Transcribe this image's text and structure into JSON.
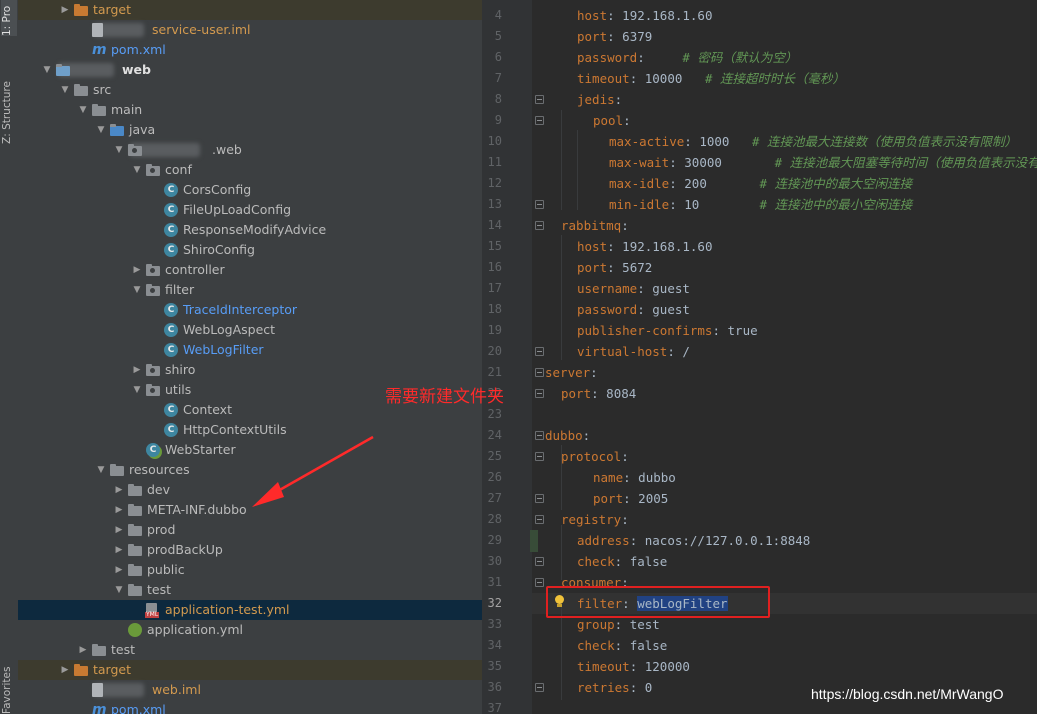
{
  "tool_tabs": {
    "project": "1: Pro",
    "structure": "Z: Structure",
    "favorites": "Favorites"
  },
  "tree": [
    {
      "label": "target",
      "icon": "folder-excluded-icon",
      "indent": 2,
      "arrow": "▶",
      "style": "orange",
      "row": "excl"
    },
    {
      "label": "service-user.iml",
      "icon": "iml-file-icon",
      "indent": 3,
      "prefix_blur": 50,
      "style": "orange"
    },
    {
      "label": "pom.xml",
      "icon": "maven-icon",
      "indent": 3,
      "style": "blue"
    },
    {
      "label": "web",
      "icon": "module-folder-icon",
      "indent": 1,
      "arrow": "▼",
      "prefix_blur": 56,
      "style": "bold"
    },
    {
      "label": "src",
      "icon": "folder-icon",
      "indent": 2,
      "arrow": "▼"
    },
    {
      "label": "main",
      "icon": "folder-icon",
      "indent": 3,
      "arrow": "▼"
    },
    {
      "label": "java",
      "icon": "source-folder-icon",
      "indent": 4,
      "arrow": "▼"
    },
    {
      "label": ".web",
      "icon": "package-icon",
      "indent": 5,
      "arrow": "▼",
      "prefix_blur": 70
    },
    {
      "label": "conf",
      "icon": "package-icon",
      "indent": 6,
      "arrow": "▼"
    },
    {
      "label": "CorsConfig",
      "icon": "class-icon",
      "indent": 7
    },
    {
      "label": "FileUpLoadConfig",
      "icon": "class-icon",
      "indent": 7
    },
    {
      "label": "ResponseModifyAdvice",
      "icon": "class-icon",
      "indent": 7
    },
    {
      "label": "ShiroConfig",
      "icon": "class-icon",
      "indent": 7
    },
    {
      "label": "controller",
      "icon": "package-icon",
      "indent": 6,
      "arrow": "▶"
    },
    {
      "label": "filter",
      "icon": "package-icon",
      "indent": 6,
      "arrow": "▼"
    },
    {
      "label": "TraceIdInterceptor",
      "icon": "class-icon",
      "indent": 7,
      "style": "blue"
    },
    {
      "label": "WebLogAspect",
      "icon": "class-icon",
      "indent": 7
    },
    {
      "label": "WebLogFilter",
      "icon": "class-icon",
      "indent": 7,
      "style": "blue"
    },
    {
      "label": "shiro",
      "icon": "package-icon",
      "indent": 6,
      "arrow": "▶"
    },
    {
      "label": "utils",
      "icon": "package-icon",
      "indent": 6,
      "arrow": "▼"
    },
    {
      "label": "Context",
      "icon": "class-icon",
      "indent": 7
    },
    {
      "label": "HttpContextUtils",
      "icon": "class-icon",
      "indent": 7
    },
    {
      "label": "WebStarter",
      "icon": "spring-boot-class-icon",
      "indent": 6
    },
    {
      "label": "resources",
      "icon": "resources-folder-icon",
      "indent": 4,
      "arrow": "▼"
    },
    {
      "label": "dev",
      "icon": "folder-icon",
      "indent": 5,
      "arrow": "▶"
    },
    {
      "label": "META-INF.dubbo",
      "icon": "folder-icon",
      "indent": 5,
      "arrow": "▶"
    },
    {
      "label": "prod",
      "icon": "folder-icon",
      "indent": 5,
      "arrow": "▶"
    },
    {
      "label": "prodBackUp",
      "icon": "folder-icon",
      "indent": 5,
      "arrow": "▶"
    },
    {
      "label": "public",
      "icon": "folder-icon",
      "indent": 5,
      "arrow": "▶"
    },
    {
      "label": "test",
      "icon": "folder-icon",
      "indent": 5,
      "arrow": "▼"
    },
    {
      "label": "application-test.yml",
      "icon": "yml-file-icon",
      "indent": 6,
      "style": "orange",
      "row": "sel"
    },
    {
      "label": "application.yml",
      "icon": "yml-spring-icon",
      "indent": 5
    },
    {
      "label": "test",
      "icon": "folder-icon",
      "indent": 3,
      "arrow": "▶"
    },
    {
      "label": "target",
      "icon": "folder-excluded-icon",
      "indent": 2,
      "arrow": "▶",
      "style": "orange",
      "row": "excl"
    },
    {
      "label": "web.iml",
      "icon": "iml-file-icon",
      "indent": 3,
      "prefix_blur": 50,
      "style": "orange"
    },
    {
      "label": "pom.xml",
      "icon": "maven-icon",
      "indent": 3,
      "style": "blue"
    }
  ],
  "editor": {
    "current_line": 32,
    "lines": [
      {
        "n": 4,
        "indent": 2,
        "key": "host",
        "val": "192.168.1.60"
      },
      {
        "n": 5,
        "indent": 2,
        "key": "port",
        "val": "6379"
      },
      {
        "n": 6,
        "indent": 2,
        "key": "password",
        "val": "   ",
        "comment": "# 密码（默认为空）"
      },
      {
        "n": 7,
        "indent": 2,
        "key": "timeout",
        "val": "10000  ",
        "comment": "# 连接超时时长（毫秒）"
      },
      {
        "n": 8,
        "indent": 2,
        "key": "jedis",
        "val": "",
        "fold": true
      },
      {
        "n": 9,
        "indent": 3,
        "key": "pool",
        "val": "",
        "fold": true
      },
      {
        "n": 10,
        "indent": 4,
        "key": "max-active",
        "val": "1000  ",
        "comment": "# 连接池最大连接数（使用负值表示没有限制）"
      },
      {
        "n": 11,
        "indent": 4,
        "key": "max-wait",
        "val": "30000      ",
        "comment": "# 连接池最大阻塞等待时间（使用负值表示没有限制）"
      },
      {
        "n": 12,
        "indent": 4,
        "key": "max-idle",
        "val": "200      ",
        "comment": "# 连接池中的最大空闲连接"
      },
      {
        "n": 13,
        "indent": 4,
        "key": "min-idle",
        "val": "10       ",
        "comment": "# 连接池中的最小空闲连接",
        "fold": true
      },
      {
        "n": 14,
        "indent": 1,
        "key": "rabbitmq",
        "val": "",
        "fold": true
      },
      {
        "n": 15,
        "indent": 2,
        "key": "host",
        "val": "192.168.1.60"
      },
      {
        "n": 16,
        "indent": 2,
        "key": "port",
        "val": "5672"
      },
      {
        "n": 17,
        "indent": 2,
        "key": "username",
        "val": "guest"
      },
      {
        "n": 18,
        "indent": 2,
        "key": "password",
        "val": "guest"
      },
      {
        "n": 19,
        "indent": 2,
        "key": "publisher-confirms",
        "val": "true"
      },
      {
        "n": 20,
        "indent": 2,
        "key": "virtual-host",
        "val": "/",
        "fold": true
      },
      {
        "n": 21,
        "indent": 0,
        "key": "server",
        "val": "",
        "fold": true
      },
      {
        "n": 22,
        "indent": 1,
        "key": "port",
        "val": "8084",
        "fold": true
      },
      {
        "n": 23,
        "indent": 0,
        "key": "",
        "val": ""
      },
      {
        "n": 24,
        "indent": 0,
        "key": "dubbo",
        "val": "",
        "fold": true
      },
      {
        "n": 25,
        "indent": 1,
        "key": "protocol",
        "val": "",
        "fold": true
      },
      {
        "n": 26,
        "indent": 3,
        "key": "name",
        "val": "dubbo"
      },
      {
        "n": 27,
        "indent": 3,
        "key": "port",
        "val": "2005",
        "fold": true
      },
      {
        "n": 28,
        "indent": 1,
        "key": "registry",
        "val": "",
        "fold": true
      },
      {
        "n": 29,
        "indent": 2,
        "key": "address",
        "val": "nacos://127.0.0.1:8848"
      },
      {
        "n": 30,
        "indent": 2,
        "key": "check",
        "val": "false",
        "fold": true
      },
      {
        "n": 31,
        "indent": 1,
        "key": "consumer",
        "val": "",
        "fold": true
      },
      {
        "n": 32,
        "indent": 2,
        "key": "filter",
        "val": "webLogFilter",
        "highlight": true
      },
      {
        "n": 33,
        "indent": 2,
        "key": "group",
        "val": "test"
      },
      {
        "n": 34,
        "indent": 2,
        "key": "check",
        "val": "false"
      },
      {
        "n": 35,
        "indent": 2,
        "key": "timeout",
        "val": "120000"
      },
      {
        "n": 36,
        "indent": 2,
        "key": "retries",
        "val": "0",
        "fold": true
      },
      {
        "n": 37,
        "indent": 0,
        "key": "",
        "val": ""
      }
    ]
  },
  "annotation": {
    "text": "需要新建文件夹",
    "color": "#ff2a2a"
  },
  "watermark": "https://blog.csdn.net/MrWangO",
  "colors": {
    "tree_bg": "#3c3f41",
    "editor_bg": "#2b2b2b",
    "yaml_key": "#cc7832",
    "comment": "#629755",
    "selection": "#0d293e"
  }
}
